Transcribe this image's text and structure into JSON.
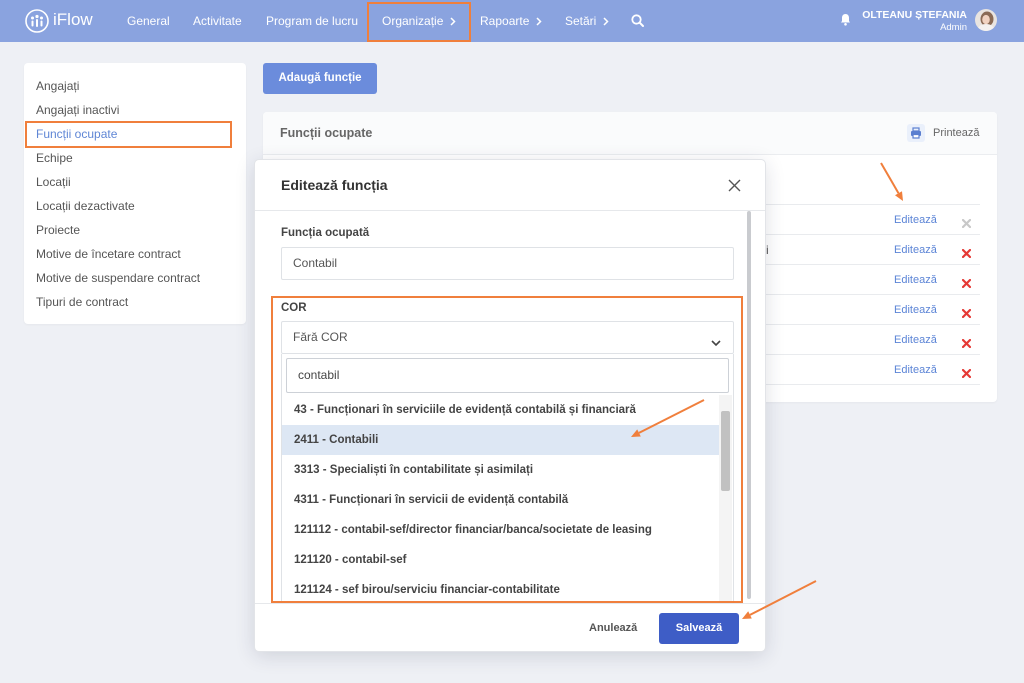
{
  "app": {
    "name": "iFlow",
    "logo_icon": "people-circle-icon"
  },
  "topnav": {
    "items": [
      {
        "label": "General",
        "has_submenu": false
      },
      {
        "label": "Activitate",
        "has_submenu": false
      },
      {
        "label": "Program de lucru",
        "has_submenu": false
      },
      {
        "label": "Organizație",
        "has_submenu": true,
        "active": true
      },
      {
        "label": "Rapoarte",
        "has_submenu": true
      },
      {
        "label": "Setări",
        "has_submenu": true
      }
    ],
    "search_icon": "search-icon",
    "notifications_icon": "bell-icon"
  },
  "user": {
    "name": "OLTEANU ȘTEFANIA",
    "role": "Admin"
  },
  "sidebar": {
    "items": [
      "Angajați",
      "Angajați inactivi",
      "Funcții ocupate",
      "Echipe",
      "Locații",
      "Locații dezactivate",
      "Proiecte",
      "Motive de încetare contract",
      "Motive de suspendare contract",
      "Tipuri de contract"
    ],
    "active_index": 2
  },
  "toolbar": {
    "add_label": "Adaugă funcție"
  },
  "card": {
    "title": "Funcții ocupate",
    "print_label": "Printează",
    "print_icon": "printer-icon",
    "rows": [
      {
        "edit_label": "Editează",
        "delete_enabled": false
      },
      {
        "name_fragment": "i",
        "edit_label": "Editează",
        "delete_enabled": true
      },
      {
        "edit_label": "Editează",
        "delete_enabled": true
      },
      {
        "edit_label": "Editează",
        "delete_enabled": true
      },
      {
        "edit_label": "Editează",
        "delete_enabled": true
      },
      {
        "edit_label": "Editează",
        "delete_enabled": true
      }
    ]
  },
  "modal": {
    "title": "Editează funcția",
    "job_field": {
      "label": "Funcția ocupată",
      "value": "Contabil"
    },
    "cor_field": {
      "label": "COR",
      "selected": "Fără COR",
      "search_value": "contabil",
      "options": [
        "43 - Funcționari în serviciile de evidență contabilă și financiară",
        "2411 - Contabili",
        "3313 - Specialiști în contabilitate și asimilați",
        "4311 - Funcționari în servicii de evidență contabilă",
        "121112 - contabil-sef/director financiar/banca/societate de leasing",
        "121120 - contabil-sef",
        "121124 - sef birou/serviciu financiar-contabilitate"
      ],
      "highlighted_index": 1
    },
    "cancel_label": "Anulează",
    "save_label": "Salvează"
  },
  "colors": {
    "topbar": "#8aa3df",
    "primary_button": "#6b8cdc",
    "save_button": "#3e5dc6",
    "link": "#5b84d6",
    "active_menu": "#5f86d5",
    "danger": "#e53935",
    "disabled": "#c8c8c8",
    "highlight_option": "#dde7f4",
    "annotation": "#f07f3c"
  }
}
